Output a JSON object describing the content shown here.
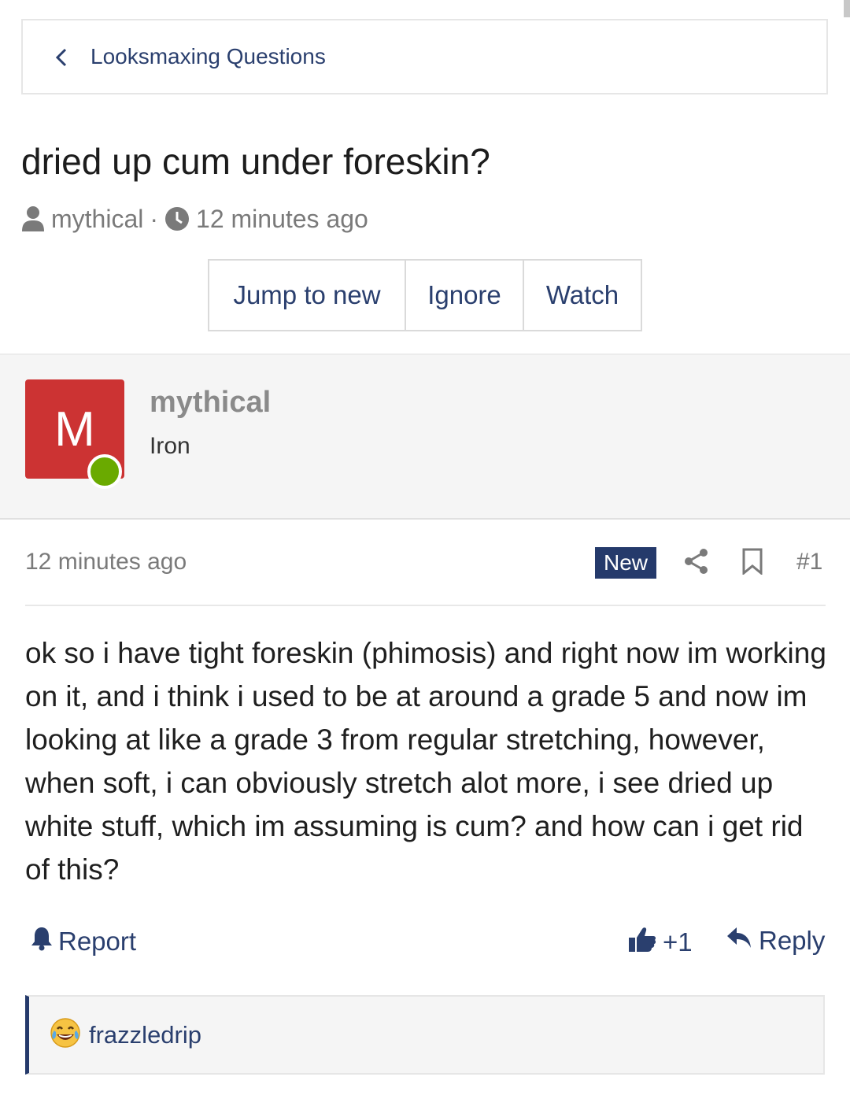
{
  "breadcrumb": {
    "label": "Looksmaxing Questions",
    "icon": "chevron-left-icon"
  },
  "thread": {
    "title": "dried up cum under foreskin?",
    "author": "mythical",
    "separator": "·",
    "time": "12 minutes ago"
  },
  "actions": {
    "jump_to_new": "Jump to new",
    "ignore": "Ignore",
    "watch": "Watch"
  },
  "post": {
    "avatar_letter": "M",
    "avatar_color": "#cc3333",
    "online_color": "#6aaa00",
    "author": "mythical",
    "rank": "Iron",
    "time": "12 minutes ago",
    "badge": "New",
    "number": "#1",
    "body": "ok so i have tight foreskin (phimosis) and right now im working on it, and i think i used to be at around a grade 5 and now im looking at like a grade 3 from regular stretching, however, when soft, i can obviously stretch alot more, i see dried up white stuff, which im assuming is cum? and how can i get rid of this?",
    "report": "Report",
    "like_count": "+1",
    "reply": "Reply"
  },
  "reactions": {
    "user": "frazzledrip",
    "emoji": "tears-of-joy-emoji"
  },
  "colors": {
    "accent": "#253a6b",
    "link": "#2a3f6e"
  }
}
